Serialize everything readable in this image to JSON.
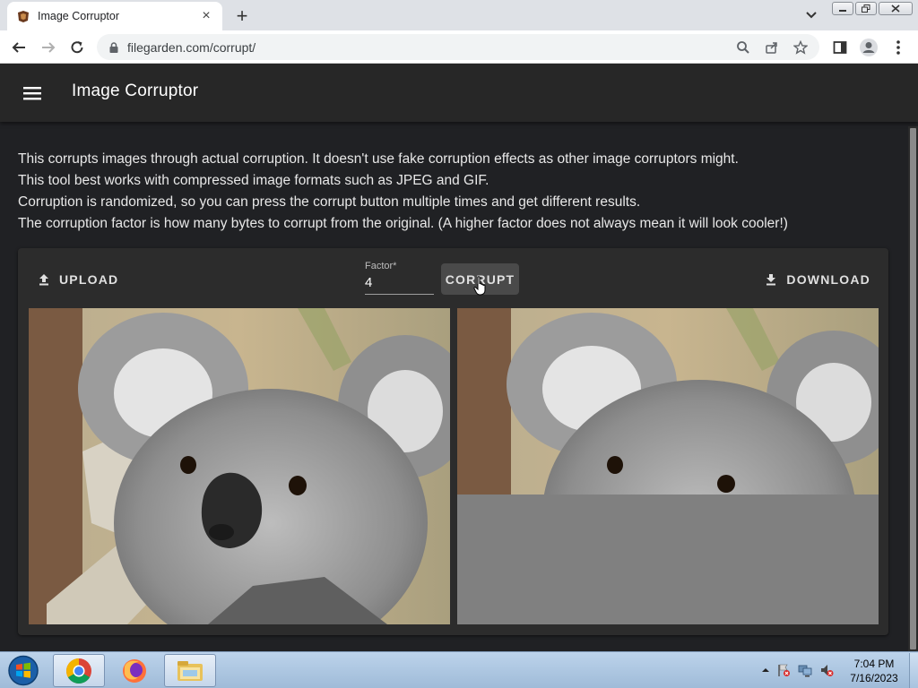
{
  "browser": {
    "tab_title": "Image Corruptor",
    "url": "filegarden.com/corrupt/"
  },
  "app": {
    "title": "Image Corruptor",
    "description": [
      "This corrupts images through actual corruption. It doesn't use fake corruption effects as other image corruptors might.",
      "This tool best works with compressed image formats such as JPEG and GIF.",
      "Corruption is randomized, so you can press the corrupt button multiple times and get different results.",
      "The corruption factor is how many bytes to corrupt from the original. (A higher factor does not always mean it will look cooler!)"
    ],
    "upload_label": "UPLOAD",
    "factor_label": "Factor*",
    "factor_value": "4",
    "corrupt_label": "CORRUPT",
    "download_label": "DOWNLOAD"
  },
  "colors": {
    "page_bg": "#202124",
    "appbar_bg": "#272727",
    "card_bg": "#2c2c2c",
    "corrupt_gray": "#808080"
  },
  "icons": {
    "menu": "hamburger-menu-icon",
    "upload": "upload-icon",
    "download": "download-icon"
  },
  "taskbar": {
    "time": "7:04 PM",
    "date": "7/16/2023"
  }
}
